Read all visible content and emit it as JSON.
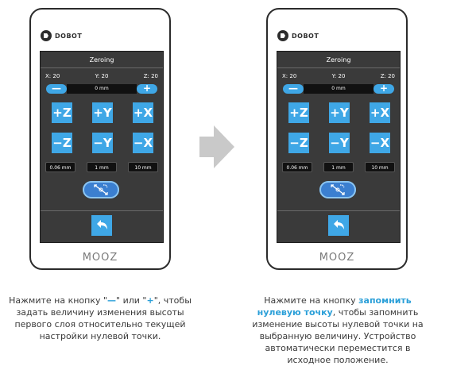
{
  "devices": [
    {
      "brand": "DOBOT",
      "screen_title": "Zeroing",
      "coords": {
        "x": "X: 20",
        "y": "Y: 20",
        "z": "Z: 20"
      },
      "stepper": {
        "minus": "—",
        "value": "0 mm",
        "plus": "+"
      },
      "axis_buttons": [
        "+Z",
        "+Y",
        "+X",
        "−Z",
        "−Y",
        "−X"
      ],
      "distances": [
        "0.06 mm",
        "1 mm",
        "10 mm"
      ],
      "model": "MOOZ"
    },
    {
      "brand": "DOBOT",
      "screen_title": "Zeroing",
      "coords": {
        "x": "X: 20",
        "y": "Y: 20",
        "z": "Z: 20"
      },
      "stepper": {
        "minus": "—",
        "value": "0 mm",
        "plus": "+"
      },
      "axis_buttons": [
        "+Z",
        "+Y",
        "+X",
        "−Z",
        "−Y",
        "−X"
      ],
      "distances": [
        "0.06 mm",
        "1 mm",
        "10 mm"
      ],
      "model": "MOOZ"
    }
  ],
  "captions": {
    "left": {
      "part1": "Нажмите на кнопку \"",
      "minus": "—",
      "part2": "\" или \"",
      "plus": "+",
      "part3": "\", чтобы задать величину изменения высоты первого слоя относительно текущей настройки нулевой точки."
    },
    "right": {
      "part1": "Нажмите на кнопку ",
      "highlight": "запомнить нулевую точку",
      "part2": ", чтобы запомнить изменение высоты нулевой точки на выбранную величину. Устройство автоматически переместится в исходное положение."
    }
  },
  "colors": {
    "accent": "#3fa7e6",
    "screen": "#3a3a3a",
    "zero_button": "#3b7fd0",
    "caption_highlight": "#2a9fd8"
  }
}
